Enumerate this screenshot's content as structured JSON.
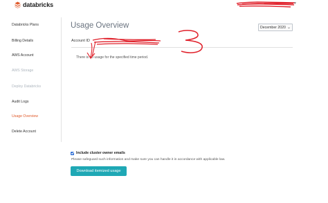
{
  "brand": {
    "name": "databricks",
    "accent": "#e05a2b"
  },
  "sidebar": {
    "items": [
      {
        "label": "Databricks Plans",
        "state": "normal"
      },
      {
        "label": "Billing Details",
        "state": "normal"
      },
      {
        "label": "AWS Account",
        "state": "normal"
      },
      {
        "label": "AWS Storage",
        "state": "disabled"
      },
      {
        "label": "Deploy Databricks",
        "state": "disabled"
      },
      {
        "label": "Audit Logs",
        "state": "normal"
      },
      {
        "label": "Usage Overview",
        "state": "active"
      },
      {
        "label": "Delete Account",
        "state": "normal"
      }
    ]
  },
  "main": {
    "title": "Usage Overview",
    "month_select": {
      "selected": "December 2020"
    },
    "account_label": "Account ID",
    "empty_message": "There is no usage for the specified time period.",
    "include_emails": {
      "checked": true,
      "label": "Include cluster owner emails"
    },
    "note": "Please safeguard such information and make sure you can handle it in accordance with applicable law.",
    "download_button": "Download itemized usage"
  },
  "colors": {
    "button": "#1fa8b5",
    "checkbox": "#2f6fd6",
    "redaction": "#e0202a"
  }
}
